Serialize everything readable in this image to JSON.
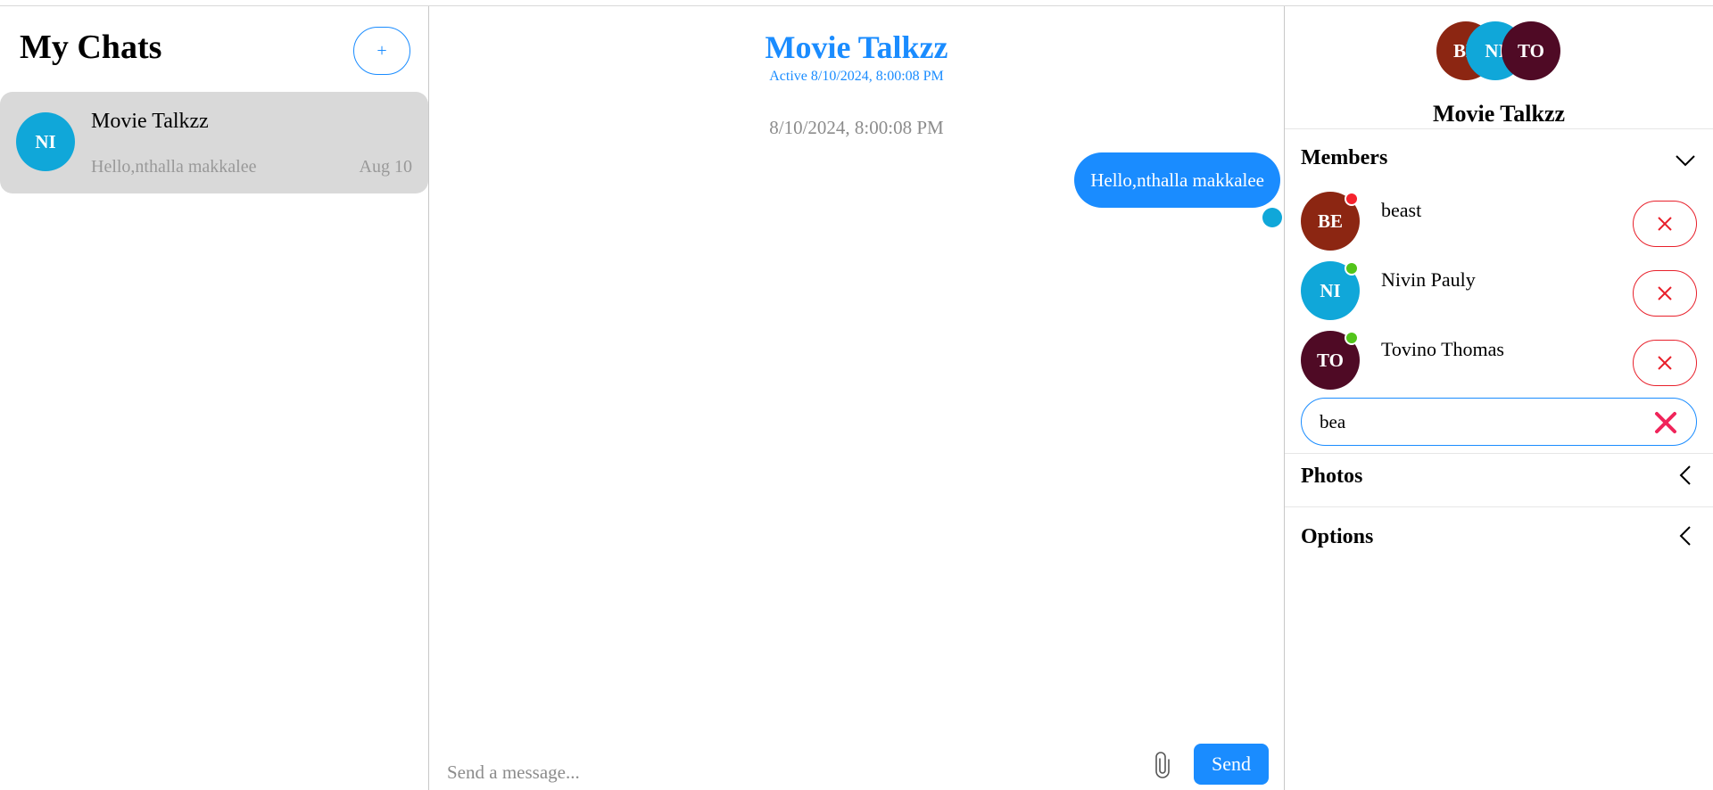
{
  "colors": {
    "accent": "#1a8cff",
    "danger": "#e8202b",
    "online": "#52c41a",
    "offline": "#f5222d"
  },
  "sidebar": {
    "title": "My Chats",
    "new_chat_label": "+",
    "chats": [
      {
        "avatar_initials": "NI",
        "avatar_color": "#10a7d9",
        "name": "Movie Talkzz",
        "last_message": "Hello,nthalla makkalee",
        "date": "Aug 10"
      }
    ]
  },
  "chat": {
    "title": "Movie Talkzz",
    "active_status": "Active 8/10/2024, 8:00:08 PM",
    "messages": [
      {
        "timestamp": "8/10/2024, 8:00:08 PM",
        "text": "Hello,nthalla makkalee",
        "outgoing": true
      }
    ],
    "composer": {
      "placeholder": "Send a message...",
      "attach_icon": "paperclip-icon",
      "send_label": "Send"
    }
  },
  "details": {
    "group_name": "Movie Talkzz",
    "group_avatars": [
      {
        "initials": "BE",
        "color": "#8c2612"
      },
      {
        "initials": "NI",
        "color": "#10a7d9"
      },
      {
        "initials": "TO",
        "color": "#4f0a25"
      }
    ],
    "members_section": {
      "label": "Members",
      "expanded": true,
      "chevron_icon": "chevron-down-icon",
      "members": [
        {
          "initials": "BE",
          "avatar_color": "#8c2612",
          "name": "beast",
          "status": "offline",
          "status_color": "#f5222d"
        },
        {
          "initials": "NI",
          "avatar_color": "#10a7d9",
          "name": "Nivin Pauly",
          "status": "online",
          "status_color": "#52c41a"
        },
        {
          "initials": "TO",
          "avatar_color": "#4f0a25",
          "name": "Tovino Thomas",
          "status": "online",
          "status_color": "#52c41a"
        }
      ],
      "search": {
        "value": "bea",
        "clear_icon": "close-icon"
      }
    },
    "photos_section": {
      "label": "Photos",
      "expanded": false,
      "chevron_icon": "chevron-left-icon"
    },
    "options_section": {
      "label": "Options",
      "expanded": false,
      "chevron_icon": "chevron-left-icon"
    }
  }
}
